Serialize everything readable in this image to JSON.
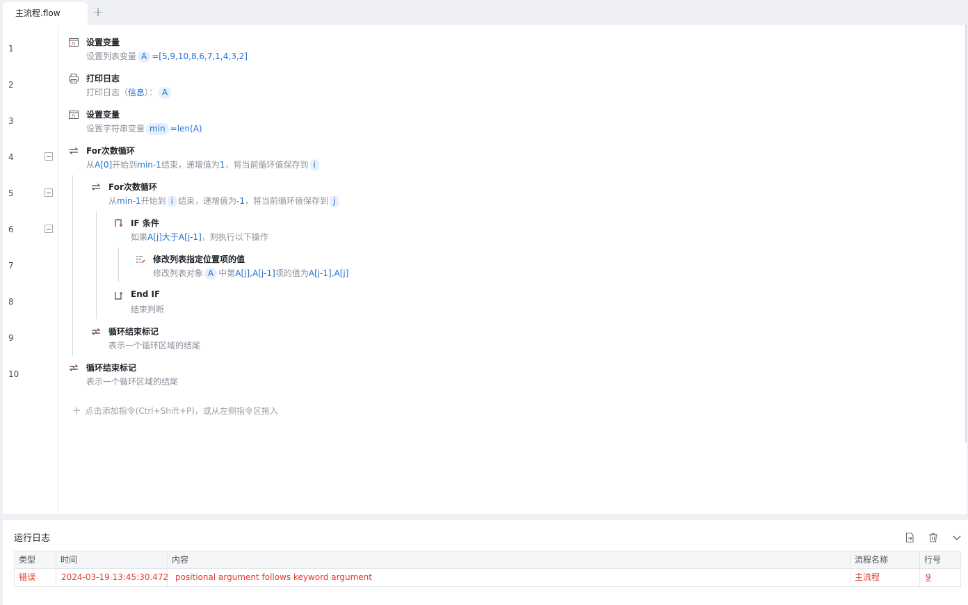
{
  "tabs": {
    "active_label": "主流程.flow",
    "add_label": "+"
  },
  "line_numbers": [
    "1",
    "2",
    "3",
    "4",
    "5",
    "6",
    "7",
    "8",
    "9",
    "10"
  ],
  "steps": [
    {
      "title": "设置变量",
      "desc_prefix": "设置列表变量",
      "var": "A",
      "desc_suffix": "=[5,9,10,8,6,7,1,4,3,2]"
    },
    {
      "title": "打印日志",
      "desc_prefix": "打印日志（",
      "level": "信息",
      "desc_mid": "）：",
      "var": "A"
    },
    {
      "title": "设置变量",
      "desc_prefix": "设置字符串变量",
      "var": "min",
      "desc_suffix": "=len(A)"
    },
    {
      "title": "For次数循环",
      "p1": "从",
      "v1": "A[0]",
      "p2": "开始到",
      "v2": "min-1",
      "p3": "结束，递增值为",
      "v3": "1",
      "p4": "，将当前循环值保存到",
      "var": "i"
    },
    {
      "title": "For次数循环",
      "p1": "从",
      "v1": "min-1",
      "p2": "开始到",
      "var1": "i",
      "p3": "结束，递增值为",
      "v3": "-1",
      "p4": "，将当前循环值保存到",
      "var": "j"
    },
    {
      "title": "IF 条件",
      "p1": "如果",
      "v1": "A[j]大于A[j-1]",
      "p2": "，则执行以下操作"
    },
    {
      "title": "修改列表指定位置项的值",
      "p1": "修改列表对象",
      "var": "A",
      "p2": "中第",
      "v1": "A[j],A[j-1]",
      "p3": "项的值为",
      "v2": "A[j-1],A[j]"
    },
    {
      "title": "End IF",
      "desc": "结束判断"
    },
    {
      "title": "循环结束标记",
      "desc": "表示一个循环区域的结尾"
    },
    {
      "title": "循环结束标记",
      "desc": "表示一个循环区域的结尾"
    }
  ],
  "add_hint": "点击添加指令(Ctrl+Shift+P)，或从左侧指令区拖入",
  "log": {
    "title": "运行日志",
    "columns": [
      "类型",
      "时间",
      "内容",
      "流程名称",
      "行号"
    ],
    "rows": [
      {
        "type": "错误",
        "time": "2024-03-19 13:45:30.472",
        "content": "positional argument follows keyword argument",
        "flow": "主流程",
        "line": "9"
      }
    ]
  },
  "colors": {
    "accent": "#1f6fd6",
    "error": "#e03b2e",
    "muted": "#8a9099"
  }
}
